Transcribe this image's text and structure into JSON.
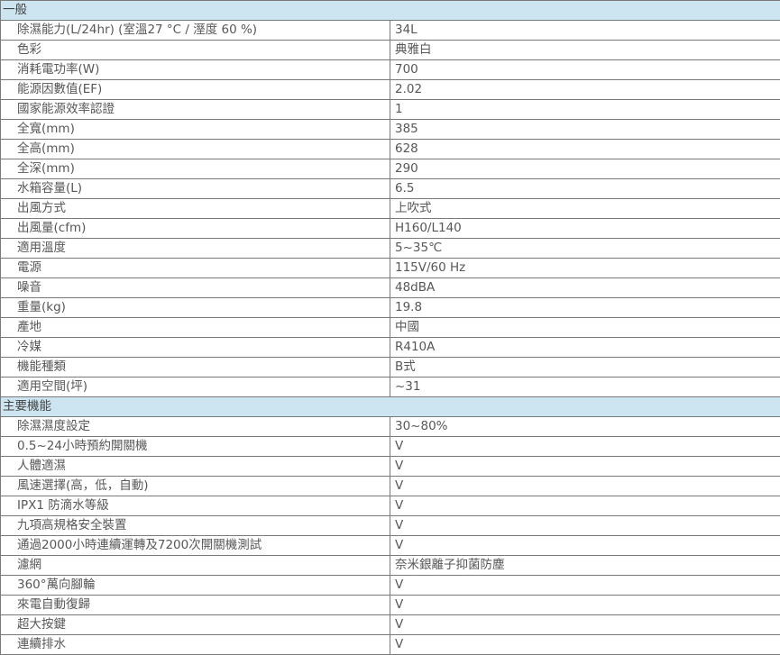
{
  "sections": [
    {
      "title": "一般",
      "rows": [
        {
          "label": "除濕能力(L/24hr) (室溫27 °C / 溼度 60 %)",
          "value": "34L"
        },
        {
          "label": "色彩",
          "value": "典雅白"
        },
        {
          "label": "消耗電功率(W)",
          "value": "700"
        },
        {
          "label": "能源因數值(EF)",
          "value": "2.02"
        },
        {
          "label": "國家能源效率認證",
          "value": "1"
        },
        {
          "label": "全寬(mm)",
          "value": "385"
        },
        {
          "label": "全高(mm)",
          "value": "628"
        },
        {
          "label": "全深(mm)",
          "value": "290"
        },
        {
          "label": "水箱容量(L)",
          "value": "6.5"
        },
        {
          "label": "出風方式",
          "value": "上吹式"
        },
        {
          "label": "出風量(cfm)",
          "value": "H160/L140"
        },
        {
          "label": "適用溫度",
          "value": "5~35℃"
        },
        {
          "label": "電源",
          "value": "115V/60 Hz"
        },
        {
          "label": "噪音",
          "value": "48dBA"
        },
        {
          "label": "重量(kg)",
          "value": "19.8"
        },
        {
          "label": "產地",
          "value": "中國"
        },
        {
          "label": "冷媒",
          "value": "R410A"
        },
        {
          "label": "機能種類",
          "value": "B式"
        },
        {
          "label": "適用空間(坪)",
          "value": "~31"
        }
      ]
    },
    {
      "title": "主要機能",
      "rows": [
        {
          "label": "除濕濕度設定",
          "value": "30~80%"
        },
        {
          "label": "0.5~24小時預約開關機",
          "value": "V"
        },
        {
          "label": "人體適濕",
          "value": "V"
        },
        {
          "label": "風速選擇(高，低，自動)",
          "value": "V"
        },
        {
          "label": "IPX1 防滴水等級",
          "value": "V"
        },
        {
          "label": "九項高規格安全裝置",
          "value": "V"
        },
        {
          "label": "通過2000小時連續運轉及7200次開關機測試",
          "value": "V"
        },
        {
          "label": "濾網",
          "value": "奈米銀離子抑菌防塵"
        },
        {
          "label": "360°萬向腳輪",
          "value": "V"
        },
        {
          "label": "來電自動復歸",
          "value": "V"
        },
        {
          "label": "超大按鍵",
          "value": "V"
        },
        {
          "label": "連續排水",
          "value": "V"
        }
      ]
    }
  ]
}
